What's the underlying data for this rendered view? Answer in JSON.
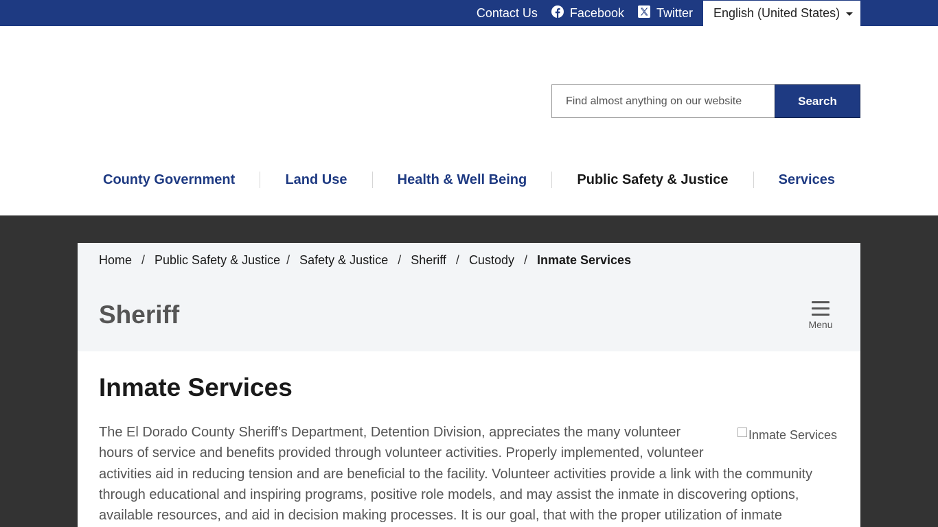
{
  "topbar": {
    "contact": "Contact Us",
    "facebook": "Facebook",
    "twitter": "Twitter",
    "language": "English (United States)"
  },
  "search": {
    "placeholder": "Find almost anything on our website",
    "button": "Search"
  },
  "nav": {
    "items": [
      {
        "label": "County Government"
      },
      {
        "label": "Land Use"
      },
      {
        "label": "Health & Well Being"
      },
      {
        "label": "Public Safety & Justice"
      },
      {
        "label": "Services"
      }
    ]
  },
  "breadcrumb": {
    "items": [
      "Home",
      "Public Safety & Justice",
      "Safety & Justice",
      "Sheriff",
      "Custody",
      "Inmate Services"
    ],
    "separator": "/"
  },
  "section": {
    "title": "Sheriff",
    "menu_label": "Menu"
  },
  "page": {
    "title": "Inmate Services",
    "image_alt": "Inmate Services",
    "body": "The El Dorado County Sheriff's Department, Detention Division, appreciates the many volunteer hours of service and benefits provided through volunteer activities. Properly implemented, volunteer activities aid in reducing tension and are beneficial to the facility. Volunteer activities provide a link with the community through educational and inspiring programs, positive role models, and may assist the inmate in discovering options, available resources, and aid in decision making processes. It is our goal, that with the proper utilization of inmate"
  },
  "colors": {
    "brand": "#1e3a82",
    "dark_background": "#333333",
    "panel": "#f3f5f7"
  },
  "icons": {
    "facebook": "facebook-icon",
    "twitter": "x-twitter-icon",
    "menu": "hamburger-menu-icon",
    "language": "chevron-down-icon"
  }
}
